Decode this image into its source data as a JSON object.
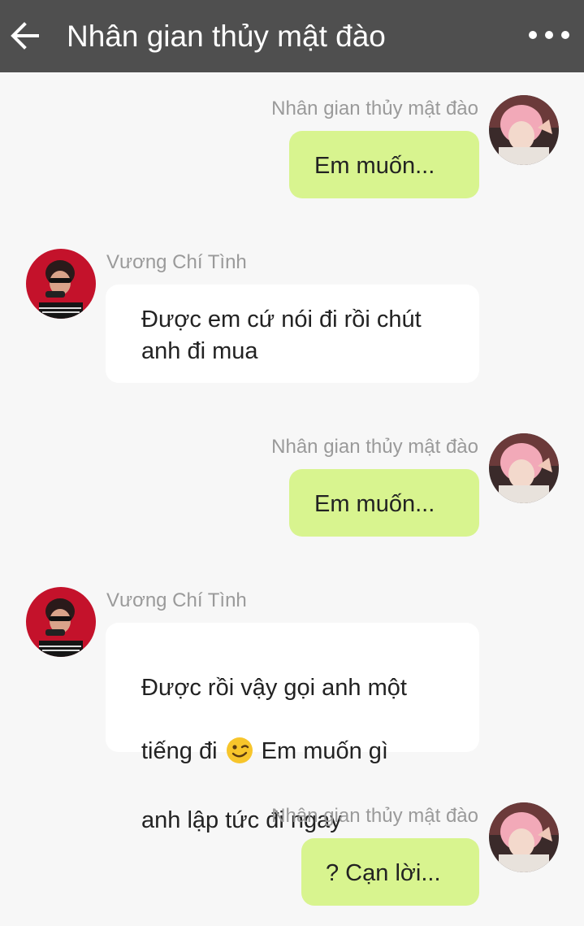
{
  "header": {
    "title": "Nhân gian thủy mật đào",
    "back_icon": "back-arrow-icon",
    "more_icon": "more-dots-icon"
  },
  "messages": [
    {
      "sender": "Nhân gian thủy mật đào",
      "side": "right",
      "text": "Em muốn..."
    },
    {
      "sender": "Vương Chí Tình",
      "side": "left",
      "text": "Được em cứ nói đi rồi chút\nanh đi mua"
    },
    {
      "sender": "Nhân gian thủy mật đào",
      "side": "right",
      "text": "Em muốn..."
    },
    {
      "sender": "Vương Chí Tình",
      "side": "left",
      "text_line1": "Được rồi vậy gọi anh một",
      "text_line2_a": "tiếng đi",
      "emoji": "winking-face",
      "text_line2_b": "Em muốn gì",
      "text_line3": "anh lập tức đi ngay"
    },
    {
      "sender": "Nhân gian thủy mật đào",
      "side": "right",
      "text": "? Cạn lời..."
    }
  ],
  "colors": {
    "header_bg": "#4f4f4f",
    "page_bg": "#f7f7f7",
    "bubble_green": "#d8f48f",
    "bubble_white": "#ffffff",
    "name_gray": "#9a9a9a"
  }
}
